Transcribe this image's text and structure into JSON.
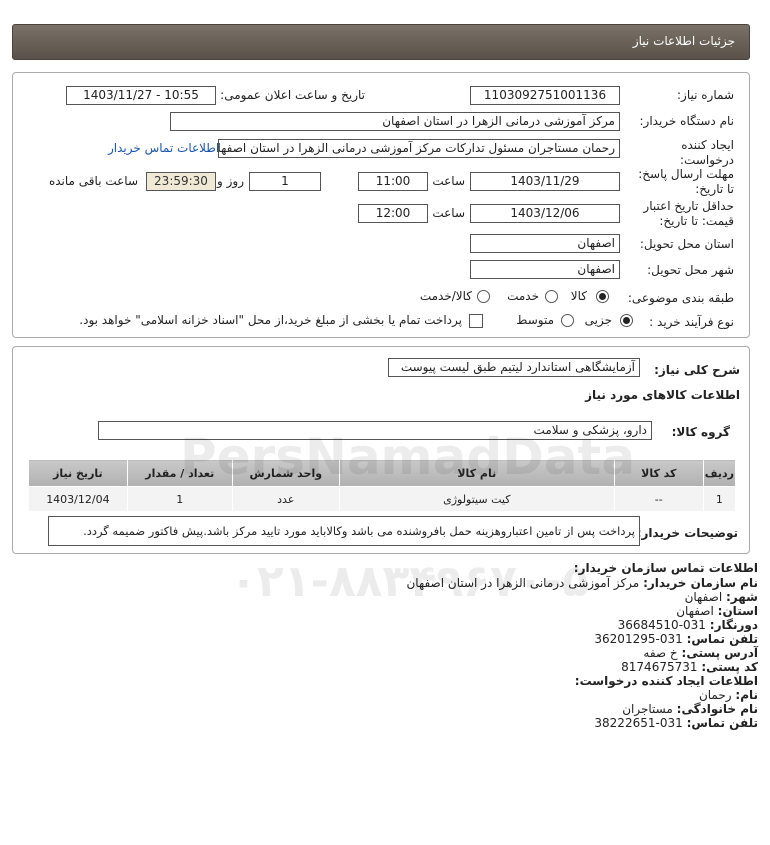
{
  "header": {
    "title": "جزئیات اطلاعات نیاز"
  },
  "form": {
    "need_number_label": "شماره نیاز:",
    "need_number": "1103092751001136",
    "announce_label": "تاریخ و ساعت اعلان عمومی:",
    "announce_value": "1403/11/27 - 10:55",
    "buyer_org_label": "نام دستگاه خریدار:",
    "buyer_org": "مرکز آموزشی درمانی الزهرا در استان اصفهان",
    "creator_label": "ایجاد کننده درخواست:",
    "creator": "رحمان مستاجران مسئول تدارکات مرکز آموزشی درمانی الزهرا در استان اصفهان",
    "contact_link": "اطلاعات تماس خریدار",
    "deadline_label": "مهلت ارسال پاسخ: تا تاریخ:",
    "deadline_date": "1403/11/29",
    "time_word": "ساعت",
    "deadline_time": "11:00",
    "days_value": "1",
    "days_word": "روز و",
    "remaining_time": "23:59:30",
    "remaining_label": "ساعت باقی مانده",
    "validity_label": "حداقل تاریخ اعتبار قیمت: تا تاریخ:",
    "validity_date": "1403/12/06",
    "validity_time": "12:00",
    "province_label": "استان محل تحویل:",
    "province": "اصفهان",
    "city_label": "شهر محل تحویل:",
    "city": "اصفهان",
    "category_label": "طبقه بندی موضوعی:",
    "category_options": [
      "کالا",
      "خدمت",
      "کالا/خدمت"
    ],
    "category_selected": "کالا",
    "process_label": "نوع فرآیند خرید :",
    "process_options": [
      "جزیی",
      "متوسط"
    ],
    "process_selected": "جزیی",
    "payment_note": "پرداخت تمام یا بخشی از مبلغ خرید،از محل \"اسناد خزانه اسلامی\" خواهد بود."
  },
  "details": {
    "summary_label": "شرح کلی نیاز:",
    "summary": "آزمایشگاهی استاندارد لیتیم طبق لیست پیوست",
    "goods_info_title": "اطلاعات کالاهای مورد نیاز",
    "goods_group_label": "گروه کالا:",
    "goods_group": "دارو، پزشکی و سلامت",
    "table": {
      "headers": [
        "ردیف",
        "کد کالا",
        "نام کالا",
        "واحد شمارش",
        "تعداد / مقدار",
        "تاریخ نیاز"
      ],
      "rows": [
        [
          "1",
          "--",
          "کیت سیتولوژی",
          "عدد",
          "1",
          "1403/12/04"
        ]
      ]
    },
    "buyer_notes_label": "توضیحات خریدار:",
    "buyer_notes": "پرداخت پس از تامین اعتباروهزینه حمل بافروشنده می باشد وکالاباید مورد تایید مرکز باشد.پیش فاکتور ضمیمه گردد."
  },
  "contact": {
    "title": "اطلاعات تماس سازمان خریدار:",
    "org_label": "نام سازمان خریدار:",
    "org": "مرکز آموزشی درمانی الزهرا در استان اصفهان",
    "city_label": "شهر:",
    "city": "اصفهان",
    "province_label": "استان:",
    "province": "اصفهان",
    "fax_label": "دورنگار:",
    "fax": "031-36684510",
    "phone_label": "تلفن تماس:",
    "phone": "031-36201295",
    "address_label": "آدرس پستی:",
    "address": "خ صفه",
    "postal_label": "کد پستی:",
    "postal": "8174675731",
    "creator_title": "اطلاعات ایجاد کننده درخواست:",
    "name_label": "نام:",
    "name": "رحمان",
    "family_label": "نام خانوادگی:",
    "family": "مستاجران",
    "creator_phone_label": "تلفن تماس:",
    "creator_phone": "031-38222651"
  },
  "watermark": {
    "brand": "PersNamadData",
    "phone": "۰۲۱-۸۸۳۴۹۶۷۰-۵"
  }
}
